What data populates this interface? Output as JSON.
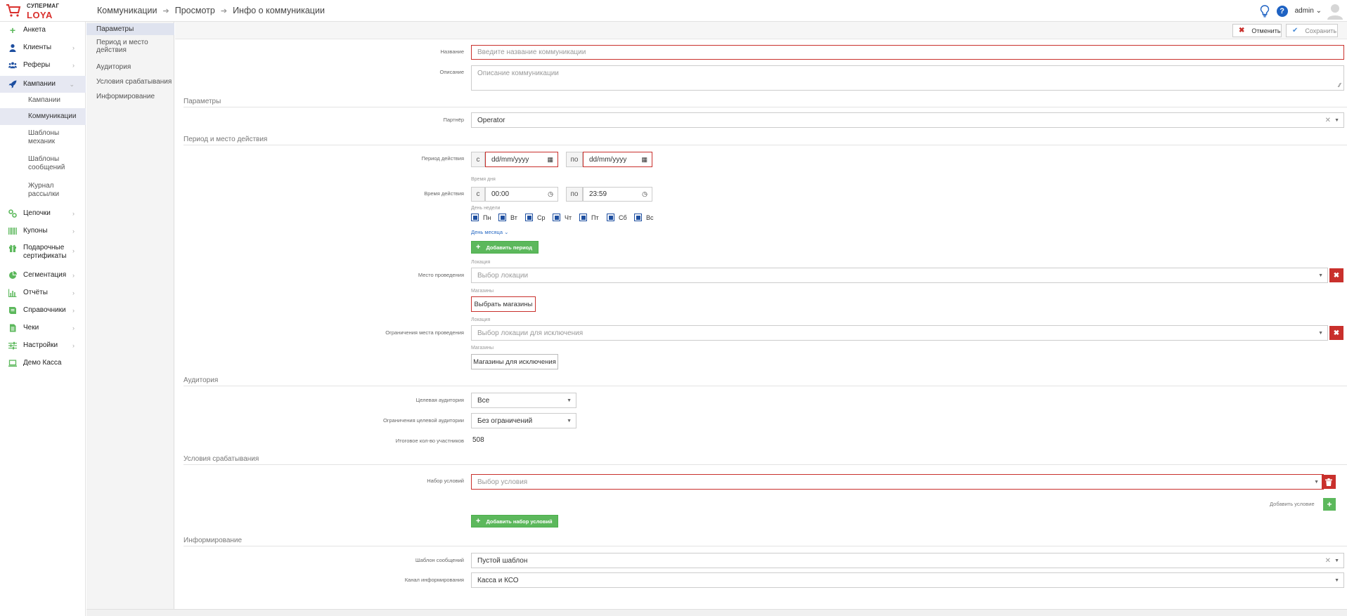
{
  "brand": {
    "line1": "СУПЕРМАГ",
    "line2": "LOYA",
    "accent": "#d9302d"
  },
  "breadcrumb": [
    "Коммуникации",
    "Просмотр",
    "Инфо о коммуникации"
  ],
  "header": {
    "user": "admin",
    "help_glyph": "?"
  },
  "sidebar": {
    "items": [
      {
        "label": "Анкета",
        "icon": "plus-icon",
        "chevron": ""
      },
      {
        "label": "Клиенты",
        "icon": "user-icon",
        "chevron": "›"
      },
      {
        "label": "Реферы",
        "icon": "users-icon",
        "chevron": "›"
      },
      {
        "label": "Кампании",
        "icon": "rocket-icon",
        "chevron": "⌄"
      },
      {
        "label": "Цепочки",
        "icon": "chain-icon",
        "chevron": "›"
      },
      {
        "label": "Купоны",
        "icon": "barcode-icon",
        "chevron": "›"
      },
      {
        "label": "Подарочные сертификаты",
        "icon": "gift-icon",
        "chevron": "›"
      },
      {
        "label": "Сегментация",
        "icon": "pie-icon",
        "chevron": "›"
      },
      {
        "label": "Отчёты",
        "icon": "bar-chart-icon",
        "chevron": "›"
      },
      {
        "label": "Справочники",
        "icon": "book-icon",
        "chevron": "›"
      },
      {
        "label": "Чеки",
        "icon": "receipt-icon",
        "chevron": "›"
      },
      {
        "label": "Настройки",
        "icon": "sliders-icon",
        "chevron": "›"
      },
      {
        "label": "Демо Касса",
        "icon": "laptop-icon",
        "chevron": ""
      }
    ],
    "subitems": [
      {
        "label": "Кампании"
      },
      {
        "label": "Коммуникации"
      },
      {
        "label": "Шаблоны механик"
      },
      {
        "label": "Шаблоны сообщений"
      },
      {
        "label": "Журнал рассылки"
      }
    ]
  },
  "subnav": [
    "Параметры",
    "Период и место действия",
    "Аудитория",
    "Условия срабатывания",
    "Информирование"
  ],
  "toolbar": {
    "cancel_label": "Отменить",
    "save_label": "Сохранить"
  },
  "form": {
    "name_label": "Название",
    "name_placeholder": "Введите название коммуникации",
    "desc_label": "Описание",
    "desc_placeholder": "Описание коммуникации",
    "sec_params": "Параметры",
    "partner_label": "Партнёр",
    "partner_value": "Operator",
    "sec_period": "Период и место действия",
    "period_label": "Период действия",
    "from_label": "с",
    "to_label": "по",
    "date_placeholder": "dd/mm/yyyy",
    "time_of_day_label": "Время дня",
    "time_label": "Время действия",
    "time_from": "00:00",
    "time_to": "23:59",
    "weekday_label": "День недели",
    "weekdays": [
      "Пн",
      "Вт",
      "Ср",
      "Чт",
      "Пт",
      "Сб",
      "Вс"
    ],
    "month_day_link": "День месяца ⌄",
    "add_period_label": "Добавить период",
    "location_small": "Локация",
    "place_label": "Место проведения",
    "location_placeholder": "Выбор локации",
    "stores_small": "Магазины",
    "choose_stores": "Выбрать магазины",
    "location_small2": "Локация",
    "restrict_label": "Ограничения места проведения",
    "exclude_location_placeholder": "Выбор локации для исключения",
    "stores_small2": "Магазины",
    "exclude_stores": "Магазины для исключения",
    "sec_audience": "Аудитория",
    "target_label": "Целевая аудитория",
    "target_value": "Все",
    "target_restrict_label": "Ограничения целевой аудитории",
    "target_restrict_value": "Без ограничений",
    "total_label": "Итоговое кол-во участников",
    "total_value": "508",
    "sec_conditions": "Условия срабатывания",
    "condset_label": "Набор условий",
    "condition_placeholder": "Выбор условия",
    "add_condition_label": "Добавить условие",
    "add_condset_label": "Добавить набор условий",
    "sec_inform": "Информирование",
    "template_label": "Шаблон сообщений",
    "template_value": "Пустой шаблон",
    "channel_label": "Канал информирования",
    "channel_value": "Касса и КСО"
  }
}
